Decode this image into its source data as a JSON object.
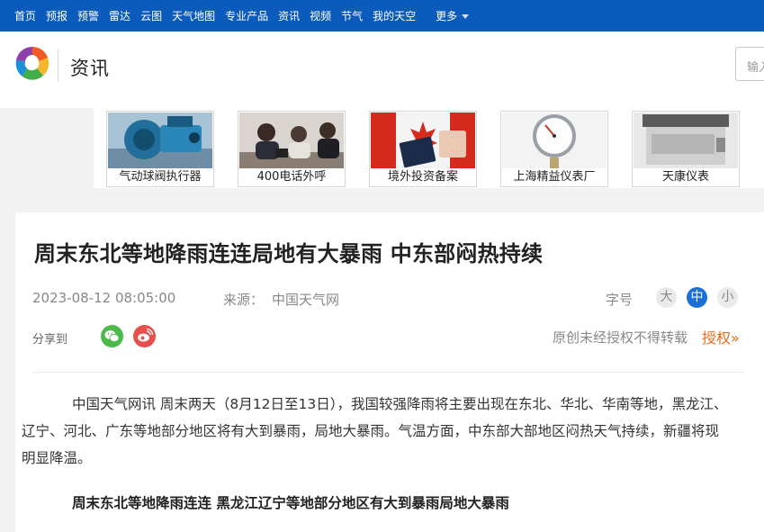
{
  "topnav": {
    "items": [
      "首页",
      "预报",
      "预警",
      "雷达",
      "云图",
      "天气地图",
      "专业产品",
      "资讯",
      "视频",
      "节气",
      "我的天空"
    ],
    "more_label": "更多"
  },
  "header": {
    "section_title": "资讯",
    "search_placeholder": "输入"
  },
  "ads": [
    {
      "label": "气动球阀执行器",
      "icon": "valve-actuator-image"
    },
    {
      "label": "400电话外呼",
      "icon": "call-center-image"
    },
    {
      "label": "境外投资备案",
      "icon": "passport-flag-image"
    },
    {
      "label": "上海精益仪表厂",
      "icon": "pressure-gauge-image"
    },
    {
      "label": "天康仪表",
      "icon": "meter-device-image"
    }
  ],
  "article": {
    "title": "周末东北等地降雨连连局地有大暴雨 中东部闷热持续",
    "date": "2023-08-12 08:05:00",
    "source_label": "来源：",
    "source": "中国天气网",
    "font_size_label": "字号",
    "font_sizes": [
      "大",
      "中",
      "小"
    ],
    "share_label": "分享到",
    "copyright_note": "原创未经授权不得转载",
    "authorize_label": "授权",
    "paragraph": "中国天气网讯 周末两天（8月12日至13日），我国较强降雨将主要出现在东北、华北、华南等地，黑龙江、辽宁、河北、广东等地部分地区将有大到暴雨，局地大暴雨。气温方面，中东部大部地区闷热天气持续，新疆将现明显降温。",
    "subheading": "周末东北等地降雨连连 黑龙江辽宁等地部分地区有大到暴雨局地大暴雨"
  },
  "colors": {
    "nav_bg": "#0b5bbd",
    "accent_blue": "#1c6fd8",
    "wechat_green": "#4cb94a",
    "weibo_red": "#e6504c",
    "authorize_orange": "#e86a1a"
  }
}
